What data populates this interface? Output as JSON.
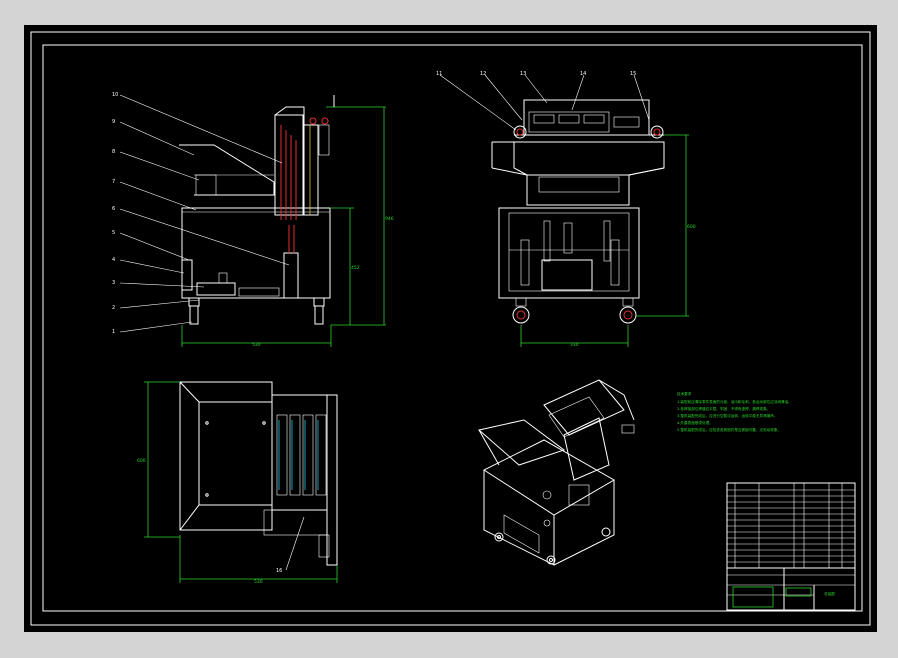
{
  "drawing": {
    "side_view_labels": [
      "10",
      "9",
      "8",
      "7",
      "6",
      "5",
      "4",
      "3",
      "2",
      "1"
    ],
    "front_view_labels": [
      "11",
      "12",
      "13",
      "14",
      "15"
    ],
    "plan_view_labels": [
      "16"
    ],
    "notes_title": "技术要求",
    "notes": [
      "1.装配前应清除零件表面的污垢、油污和毛刺，各运动部位应涂润滑油。",
      "2.各焊接部位焊缝应平整、牢固，不得有虚焊、漏焊现象。",
      "3.整机装配完成后，应进行空载试运转，运转平稳无异常噪声。",
      "4.外露表面喷漆处理。",
      "5.整机装配完成后，应检查各紧固件是否紧固可靠，无松动现象。"
    ],
    "title_block": {
      "name": "总装图"
    }
  },
  "colors": {
    "background": "#000000",
    "frame": "#ffffff",
    "dimension": "#2bd42b",
    "highlight": "#e03030"
  }
}
